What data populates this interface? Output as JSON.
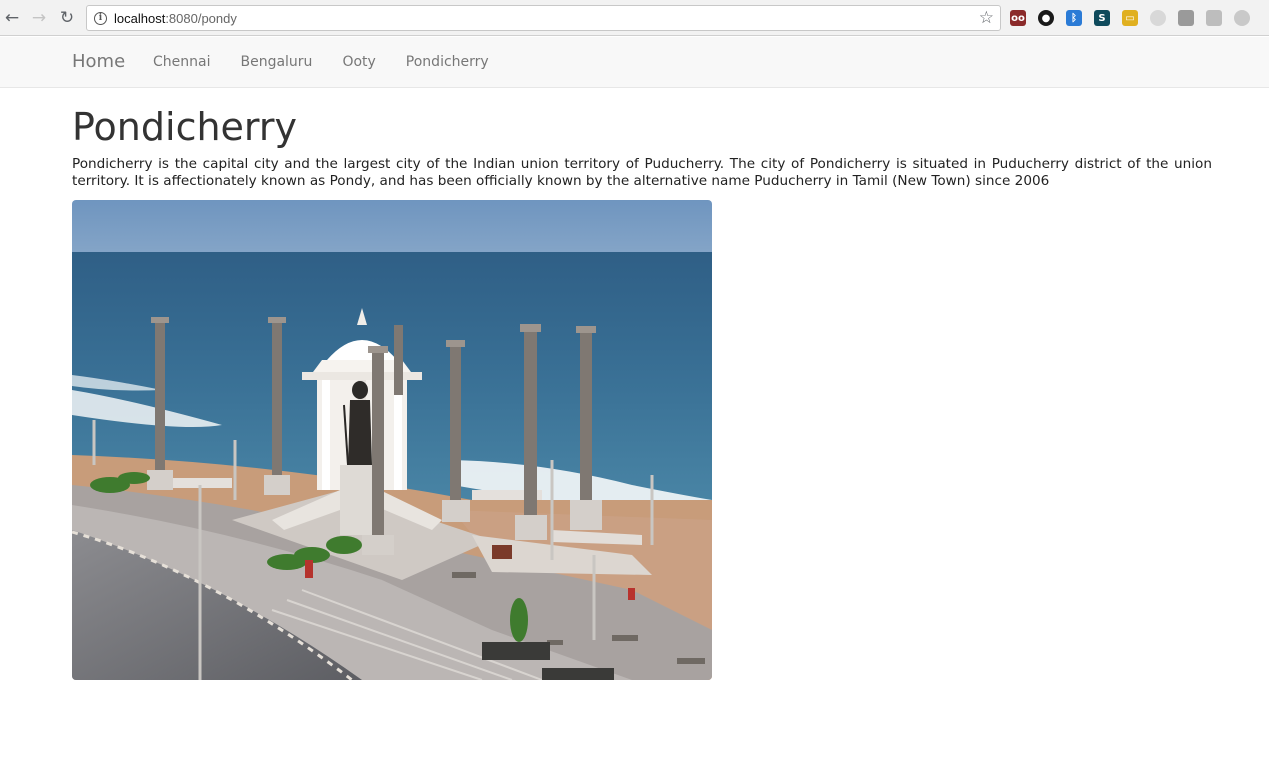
{
  "browser": {
    "url_host": "localhost",
    "url_path": ":8080/pondy",
    "extensions": [
      {
        "name": "glasses-extension-icon",
        "color": "#8b2a2a",
        "glyph": "oo"
      },
      {
        "name": "color-wheel-extension-icon",
        "color": "#1a1a1a",
        "glyph": "●"
      },
      {
        "name": "bluetooth-extension-icon",
        "color": "#2b7bd6",
        "glyph": "ᛒ"
      },
      {
        "name": "s-extension-icon",
        "color": "#0e4a5c",
        "glyph": "S"
      },
      {
        "name": "ruler-extension-icon",
        "color": "#e0b020",
        "glyph": "▭"
      },
      {
        "name": "grey-circle-extension-icon",
        "color": "#d8d8d8",
        "glyph": ""
      },
      {
        "name": "puzzle-extension-icon",
        "color": "#9a9a9a",
        "glyph": ""
      },
      {
        "name": "square-extension-icon",
        "color": "#bdbdbd",
        "glyph": ""
      },
      {
        "name": "clock-extension-icon",
        "color": "#c9c9c9",
        "glyph": ""
      }
    ]
  },
  "navbar": {
    "brand": "Home",
    "links": [
      "Chennai",
      "Bengaluru",
      "Ooty",
      "Pondicherry"
    ]
  },
  "page": {
    "title": "Pondicherry",
    "description": "Pondicherry is the capital city and the largest city of the Indian union territory of Puducherry. The city of Pondicherry is situated in Puducherry district of the union territory. It is affectionately known as Pondy, and has been officially known by the alternative name Puducherry in Tamil (New Town) since 2006"
  }
}
